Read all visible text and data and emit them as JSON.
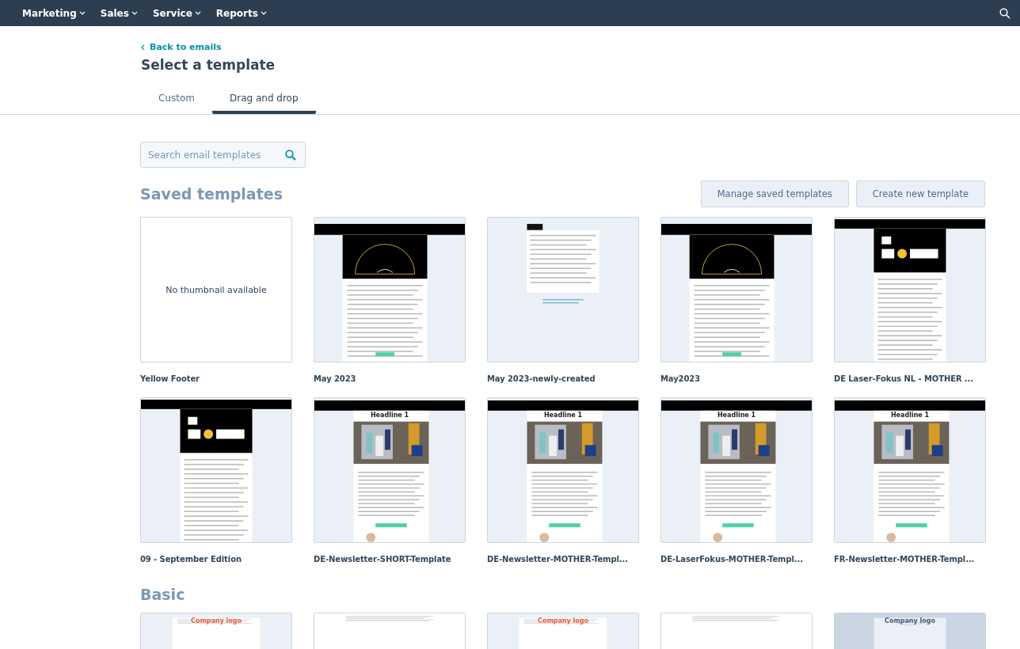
{
  "nav": {
    "items": [
      {
        "label": "Marketing"
      },
      {
        "label": "Sales"
      },
      {
        "label": "Service"
      },
      {
        "label": "Reports"
      }
    ]
  },
  "back_link": "Back to emails",
  "title": "Select a template",
  "tabs": [
    {
      "label": "Custom",
      "selected": false
    },
    {
      "label": "Drag and drop",
      "selected": true
    }
  ],
  "search": {
    "placeholder": "Search email templates"
  },
  "saved": {
    "heading": "Saved templates",
    "buttons": [
      "Manage saved templates",
      "Create new template"
    ],
    "templates": [
      {
        "name": "Yellow Footer",
        "thumb": {
          "kind": "none",
          "text": "No thumbnail available"
        }
      },
      {
        "name": "May 2023",
        "thumb": {
          "kind": "hero"
        }
      },
      {
        "name": "May 2023-newly-created",
        "thumb": {
          "kind": "plain"
        }
      },
      {
        "name": "May2023",
        "thumb": {
          "kind": "hero"
        }
      },
      {
        "name": "DE Laser-Fokus NL - MOTHER ...",
        "thumb": {
          "kind": "laser"
        }
      },
      {
        "name": "09 - September Edition",
        "thumb": {
          "kind": "laser"
        }
      },
      {
        "name": "DE-Newsletter-SHORT-Template",
        "thumb": {
          "text": "Headline 1"
        }
      },
      {
        "name": "DE-Newsletter-MOTHER-Templ...",
        "thumb": {
          "text": "Headline 1"
        }
      },
      {
        "name": "DE-LaserFokus-MOTHER-Templ...",
        "thumb": {
          "text": "Headline 1"
        }
      },
      {
        "name": "FR-Newsletter-MOTHER-Templ...",
        "thumb": {
          "text": "Headline 1"
        }
      }
    ]
  },
  "basic": {
    "heading": "Basic",
    "templates": [
      {
        "thumb": {
          "kind": "logo",
          "text": "Company logo"
        }
      },
      {
        "thumb": {
          "kind": "letter"
        }
      },
      {
        "thumb": {
          "kind": "logo",
          "text": "Company logo"
        }
      },
      {
        "thumb": {
          "kind": "letter"
        }
      },
      {
        "thumb": {
          "kind": "logo-dark",
          "text": "Company logo"
        }
      }
    ]
  }
}
